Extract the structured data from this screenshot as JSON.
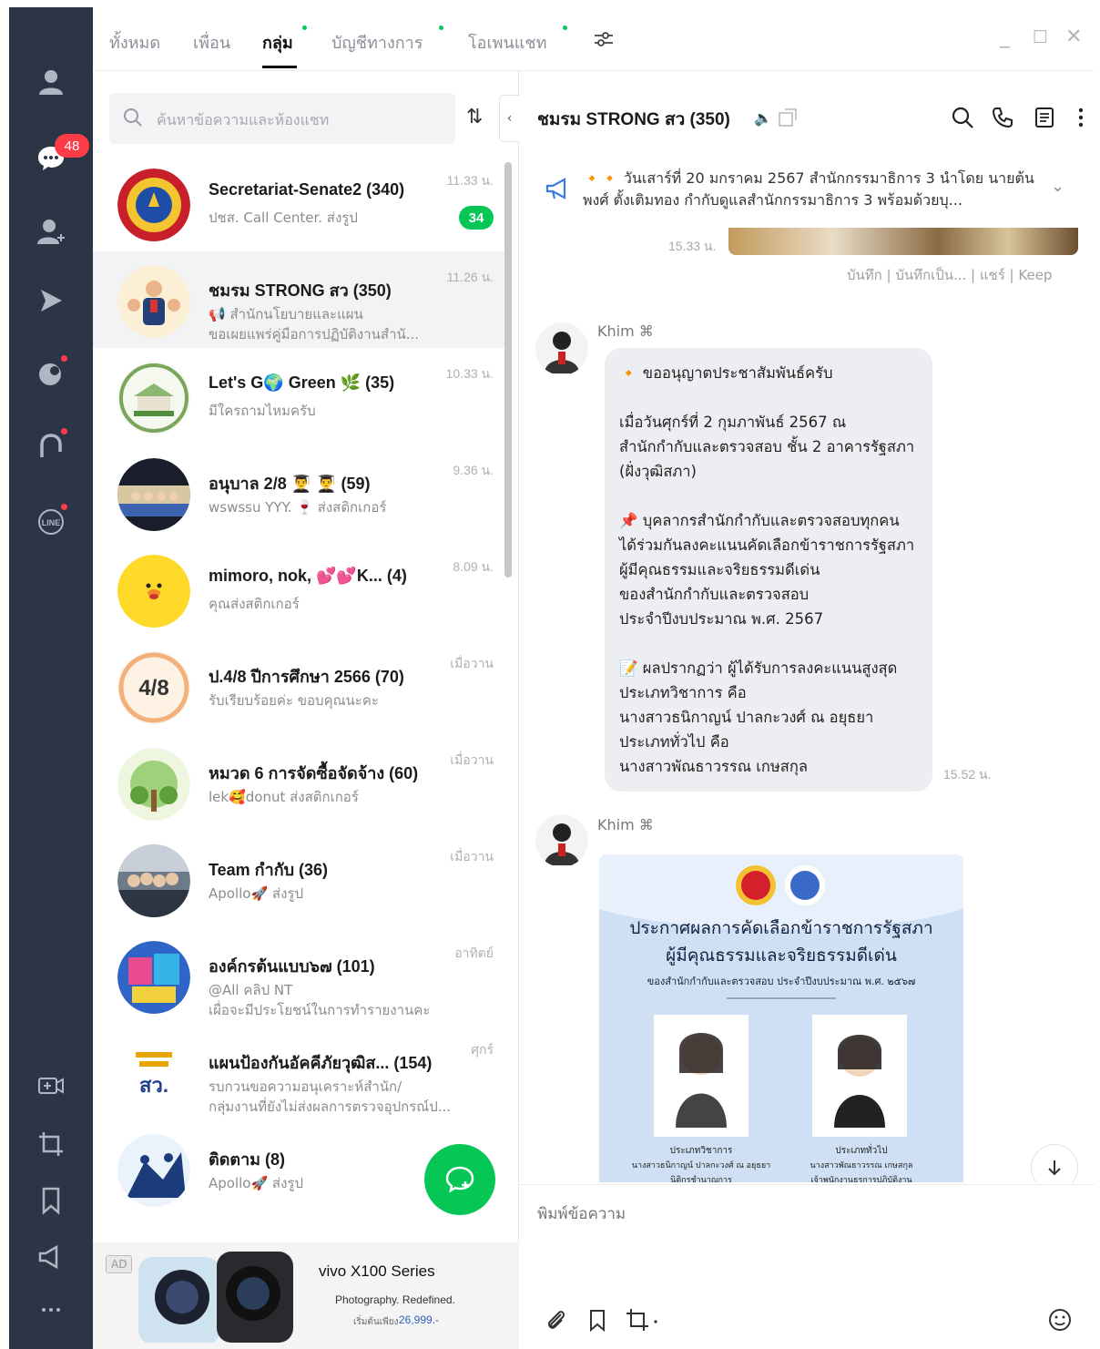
{
  "sidebar": {
    "badge_count": "48"
  },
  "tabs": [
    {
      "label": "ทั้งหมด"
    },
    {
      "label": "เพื่อน"
    },
    {
      "label": "กลุ่ม"
    },
    {
      "label": "บัญชีทางการ"
    },
    {
      "label": "โอเพนแชท"
    }
  ],
  "search": {
    "placeholder": "ค้นหาข้อความและห้องแชท"
  },
  "chats": [
    {
      "name": "Secretariat-Senate2 (340)",
      "preview1": "ปชส. Call Center. ส่งรูป",
      "preview2": "",
      "time": "11.33 น.",
      "unread": "34"
    },
    {
      "name": "ชมรม STRONG สว (350)",
      "preview1": "📢 สำนักนโยบายและแผน",
      "preview2": "ขอเผยแพร่คู่มือการปฏิบัติงานสำนั...",
      "time": "11.26 น.",
      "unread": ""
    },
    {
      "name": "Let's G🌍 Green 🌿 (35)",
      "preview1": "มีใครถามไหมครับ",
      "preview2": "",
      "time": "10.33 น.",
      "unread": ""
    },
    {
      "name": "อนุบาล 2/8 👨‍🎓 👨‍🎓 (59)",
      "preview1": "wswssu YYY. 🍷 ส่งสติกเกอร์",
      "preview2": "",
      "time": "9.36 น.",
      "unread": ""
    },
    {
      "name": "mimoro, nok, 💕💕K... (4)",
      "preview1": "คุณส่งสติกเกอร์",
      "preview2": "",
      "time": "8.09 น.",
      "unread": ""
    },
    {
      "name": "ป.4/8 ปีการศึกษา 2566 (70)",
      "preview1": "รับเรียบร้อยค่ะ ขอบคุณนะคะ",
      "preview2": "",
      "time": "เมื่อวาน",
      "unread": ""
    },
    {
      "name": "หมวด 6 การจัดซื้อจัดจ้าง (60)",
      "preview1": "lek🥰donut ส่งสติกเกอร์",
      "preview2": "",
      "time": "เมื่อวาน",
      "unread": ""
    },
    {
      "name": "Team กำกับ (36)",
      "preview1": "Apollo🚀 ส่งรูป",
      "preview2": "",
      "time": "เมื่อวาน",
      "unread": ""
    },
    {
      "name": "องค์กรต้นแบบ๖๗ (101)",
      "preview1": "@All คลิป NT",
      "preview2": "เผื่อจะมีประโยชน์ในการทำรายงานคะ",
      "time": "อาทิตย์",
      "unread": ""
    },
    {
      "name": "แผนป้องกันอัคคีภัยวุฒิส... (154)",
      "preview1": "รบกวนขอความอนุเคราะห์สำนัก/",
      "preview2": "กลุ่มงานที่ยังไม่ส่งผลการตรวจอุปกรณ์ป...",
      "time": "ศุกร์",
      "unread": ""
    },
    {
      "name": "ติดตาม (8)",
      "preview1": "Apollo🚀 ส่งรูป",
      "preview2": "",
      "time": "",
      "unread": ""
    }
  ],
  "ad": {
    "label": "AD",
    "brand": "vivo X100 Series",
    "tagline": "Photography. Redefined.",
    "price_prefix": "เริ่มต้นเพียง",
    "price": "26,999.-"
  },
  "chat": {
    "room_title": "ชมรม STRONG สว (350)",
    "announcement": "🔸🔸 วันเสาร์ที่ 20 มกราคม 2567 สำนักกรรมาธิการ 3 นำโดย นายต้นพงศ์ ตั้งเติมทอง กำกับดูแลสำนักกรรมาธิการ 3 พร้อมด้วยบุ...",
    "prev_time": "15.33 น.",
    "prev_actions": "บันทึก | บันทึกเป็น... | แชร์ | Keep",
    "messages": [
      {
        "sender": "Khim ⌘",
        "text": "🔸 ขออนุญาตประชาสัมพันธ์ครับ\n\nเมื่อวันศุกร์ที่ 2 กุมภาพันธ์ 2567 ณ\nสำนักกำกับและตรวจสอบ ชั้น 2 อาคารรัฐสภา\n(ฝั่งวุฒิสภา)\n\n📌 บุคลากรสำนักกำกับและตรวจสอบทุกคน\nได้ร่วมกันลงคะแนนคัดเลือกข้าราชการรัฐสภา\nผู้มีคุณธรรมและจริยธรรมดีเด่น\nของสำนักกำกับและตรวจสอบ\nประจำปีงบประมาณ พ.ศ. 2567\n\n📝 ผลปรากฏว่า ผู้ได้รับการลงคะแนนสูงสุด\nประเภทวิชาการ  คือ\nนางสาวธนิกาญน์  ปาลกะวงศ์ ณ อยุธยา\nประเภททั่วไป      คือ\nนางสาวพัณธาวรรณ  เกษสกุล",
        "time": "15.52 น."
      },
      {
        "sender": "Khim ⌘",
        "poster_title": "ประกาศผลการคัดเลือกข้าราชการรัฐสภา",
        "poster_subtitle": "ผู้มีคุณธรรมและจริยธรรมดีเด่น",
        "poster_line": "ของสำนักกำกับและตรวจสอบ ประจำปีงบประมาณ พ.ศ. ๒๕๖๗",
        "person1_type": "ประเภทวิชาการ",
        "person1_name": "นางสาวธนิกาญน์ ปาลกะวงศ์ ณ อยุธยา",
        "person1_role": "นิติกรชำนาญการ",
        "person2_type": "ประเภททั่วไป",
        "person2_name": "นางสาวพัณธาวรรณ เกษสกุล",
        "person2_role": "เจ้าพนักงานธุรการปฏิบัติงาน"
      }
    ],
    "input_placeholder": "พิมพ์ข้อความ"
  },
  "colors": {
    "rail": "#2c3545",
    "accent_green": "#06c755",
    "badge_red": "#ff3b48"
  }
}
